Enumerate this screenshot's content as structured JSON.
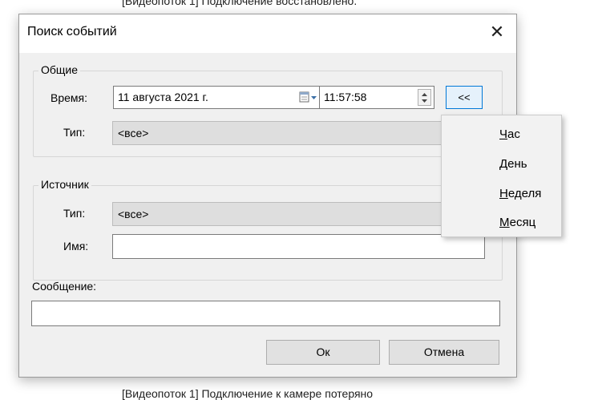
{
  "background": {
    "top_text": "[Видеопоток 1] Подключение восстановлено.",
    "bottom_text": "[Видеопоток 1] Подключение к камере потеряно"
  },
  "dialog": {
    "title": "Поиск событий",
    "close_glyph": "✕",
    "general": {
      "legend": "Общие",
      "time_label": "Время:",
      "date_value": "11  августа  2021 г.",
      "time_value": "11:57:58",
      "collapse_label": "<<",
      "type_label": "Тип:",
      "type_value": "<все>"
    },
    "source": {
      "legend": "Источник",
      "type_label": "Тип:",
      "type_value": "<все>",
      "name_label": "Имя:",
      "name_value": ""
    },
    "message_label": "Сообщение:",
    "message_value": "",
    "ok_label": "Ок",
    "cancel_label": "Отмена"
  },
  "menu": {
    "items": [
      {
        "accel": "Ч",
        "rest": "ас"
      },
      {
        "accel": "Д",
        "rest": "ень"
      },
      {
        "accel": "Н",
        "rest": "еделя"
      },
      {
        "accel": "М",
        "rest": "есяц"
      }
    ]
  },
  "icons": {
    "calendar": "calendar-dropdown-icon",
    "spinner": "time-spinner-icon",
    "close": "close-icon"
  },
  "colors": {
    "accent_border": "#0078d7",
    "accent_fill": "#e5f1fb",
    "disabled_fill": "#dedede"
  }
}
